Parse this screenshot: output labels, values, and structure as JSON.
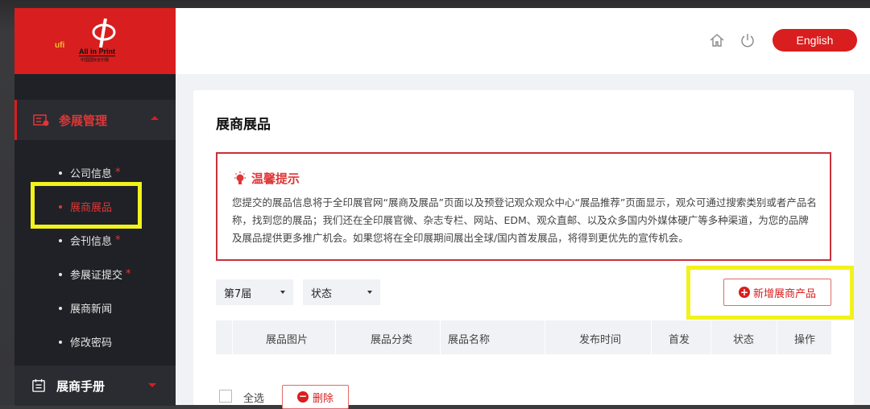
{
  "colors": {
    "brand_red": "#d81e1e",
    "sidebar_bg": "#1f2126",
    "highlight": "#f2f21d",
    "content_bg": "#f1f2f5"
  },
  "logo": {
    "ufi": "ufi",
    "brand": "All in Print",
    "brand_cn": "中国国际全印展"
  },
  "header": {
    "home_icon": "home-icon",
    "power_icon": "power-icon",
    "language_button": "English"
  },
  "sidebar": {
    "group_exhibit": {
      "label": "参展管理",
      "icon": "exhibit-management-icon"
    },
    "items": [
      {
        "label": "公司信息",
        "required": "*"
      },
      {
        "label": "展商展品",
        "required": ""
      },
      {
        "label": "会刊信息",
        "required": "*"
      },
      {
        "label": "参展证提交",
        "required": "*"
      },
      {
        "label": "展商新闻",
        "required": ""
      },
      {
        "label": "修改密码",
        "required": ""
      }
    ],
    "group_manual": {
      "label": "展商手册",
      "icon": "manual-icon"
    }
  },
  "main": {
    "title": "展商展品",
    "notice": {
      "icon": "lightbulb-icon",
      "title": "温馨提示",
      "body": "您提交的展品信息将于全印展官网“展商及展品”页面以及预登记观众观众中心“展品推荐”页面显示，观众可通过搜索类别或者产品名称，找到您的展品；我们还在全印展官微、杂志专栏、网站、EDM、观众直邮、以及众多国内外媒体硬广等多种渠道，为您的品牌及展品提供更多推广机会。如果您将在全印展期间展出全球/国内首发展品，将得到更优先的宣传机会。"
    },
    "filters": {
      "session": "第7届",
      "status": "状态"
    },
    "add_button": "新增展商产品",
    "table": {
      "columns": [
        "展品图片",
        "展品分类",
        "展品名称",
        "发布时间",
        "首发",
        "状态",
        "操作"
      ]
    },
    "footer": {
      "select_all": "全选",
      "delete_button": "删除"
    }
  }
}
